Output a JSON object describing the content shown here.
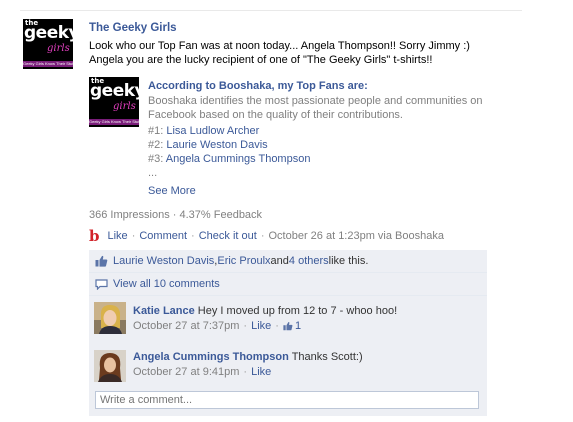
{
  "story": {
    "author": "The Geeky Girls",
    "message_line1": "Look who our Top Fan was at noon today... Angela Thompson!! Sorry Jimmy :)",
    "message_line2": "Angela you are the lucky recipient of one of \"The Geeky Girls\" t-shirts!!",
    "logo": {
      "the": "the",
      "geeky": "geeky",
      "girls": "girls",
      "tagline": "Geeky Girls Know Their Stuff"
    }
  },
  "attachment": {
    "title": "According to Booshaka, my Top Fans are:",
    "description": "Booshaka identifies the most passionate people and communities on Facebook based on the quality of their contributions.",
    "fans": [
      {
        "rank": "#1: ",
        "name": "Lisa Ludlow Archer"
      },
      {
        "rank": "#2: ",
        "name": "Laurie Weston Davis"
      },
      {
        "rank": "#3: ",
        "name": "Angela Cummings Thompson"
      }
    ],
    "ellipsis": "...",
    "see_more": "See More"
  },
  "stats": {
    "impressions": "366 Impressions",
    "separator": " · ",
    "feedback": "4.37% Feedback"
  },
  "actions": {
    "icon_letter": "b",
    "like": "Like",
    "comment": "Comment",
    "check_it_out": "Check it out",
    "timestamp": "October 26 at 1:23pm via Booshaka"
  },
  "likes": {
    "person1": "Laurie Weston Davis",
    "comma": ", ",
    "person2": "Eric Proulx",
    "and": " and ",
    "others": "4 others",
    "suffix": " like this."
  },
  "view_all": "View all 10 comments",
  "comments": [
    {
      "name": "Katie Lance",
      "text": " Hey I moved up from 12 to 7 - whoo hoo!",
      "time": "October 27 at 7:37pm",
      "like": "Like",
      "like_count": "1"
    },
    {
      "name": "Angela Cummings Thompson",
      "text": " Thanks Scott:)",
      "time": "October 27 at 9:41pm",
      "like": "Like"
    }
  ],
  "composer": {
    "placeholder": "Write a comment..."
  },
  "colors": {
    "link": "#3b5998",
    "ufi_background": "#edeff4",
    "booshaka_red": "#d2232a"
  }
}
